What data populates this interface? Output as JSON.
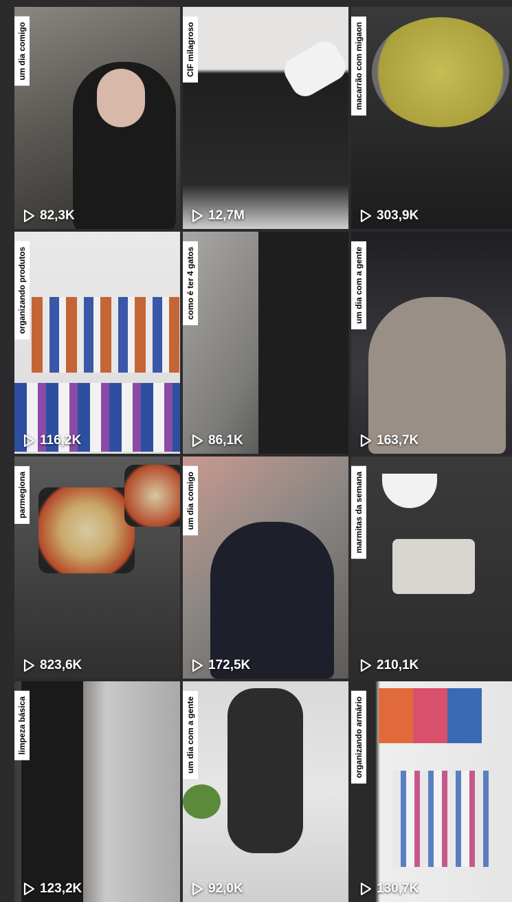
{
  "videos": [
    {
      "caption": "um dia comigo",
      "views": "82,3K",
      "bg": [
        "#5c5a55",
        "#2f2d2b",
        "#8a8680"
      ]
    },
    {
      "caption": "CIF milagroso",
      "views": "12,7M",
      "bg": [
        "#e5e4e2",
        "#1f1f1f",
        "#6b6b6b"
      ]
    },
    {
      "caption": "macarrão com migaon",
      "views": "303,9K",
      "bg": [
        "#3a3a3a",
        "#b9b04a",
        "#1c1c1c"
      ]
    },
    {
      "caption": "organizando produtos",
      "views": "116,2K",
      "bg": [
        "#e9e9ea",
        "#c46535",
        "#3b57a8"
      ]
    },
    {
      "caption": "como é ter 4 gatos",
      "views": "86,1K",
      "bg": [
        "#7c7b79",
        "#2b2b2b",
        "#aaa8a4"
      ]
    },
    {
      "caption": "um dia com a gente",
      "views": "163,7K",
      "bg": [
        "#3b3b3f",
        "#9a8f86",
        "#1f1f23"
      ]
    },
    {
      "caption": "parmegiona",
      "views": "823,6K",
      "bg": [
        "#3f3f3f",
        "#b44b2a",
        "#d7c9a3"
      ]
    },
    {
      "caption": "um dia comigo",
      "views": "172,5K",
      "bg": [
        "#8b8784",
        "#1d1f2a",
        "#c99a8f"
      ]
    },
    {
      "caption": "marmitas da semana",
      "views": "210,1K",
      "bg": [
        "#2c2c2c",
        "#d9d6cf",
        "#a26a3a"
      ]
    },
    {
      "caption": "limpeza básica",
      "views": "123,2K",
      "bg": [
        "#c9c9c9",
        "#2a2a2a",
        "#6f6a63"
      ]
    },
    {
      "caption": "um dia com a gente",
      "views": "92,0K",
      "bg": [
        "#e6e6e6",
        "#2c2c2c",
        "#5b8a3b"
      ]
    },
    {
      "caption": "organizando armário",
      "views": "130,7K",
      "bg": [
        "#eeeeee",
        "#2a2a2a",
        "#e06a3a"
      ]
    }
  ],
  "play_icon": "play-outline-icon"
}
